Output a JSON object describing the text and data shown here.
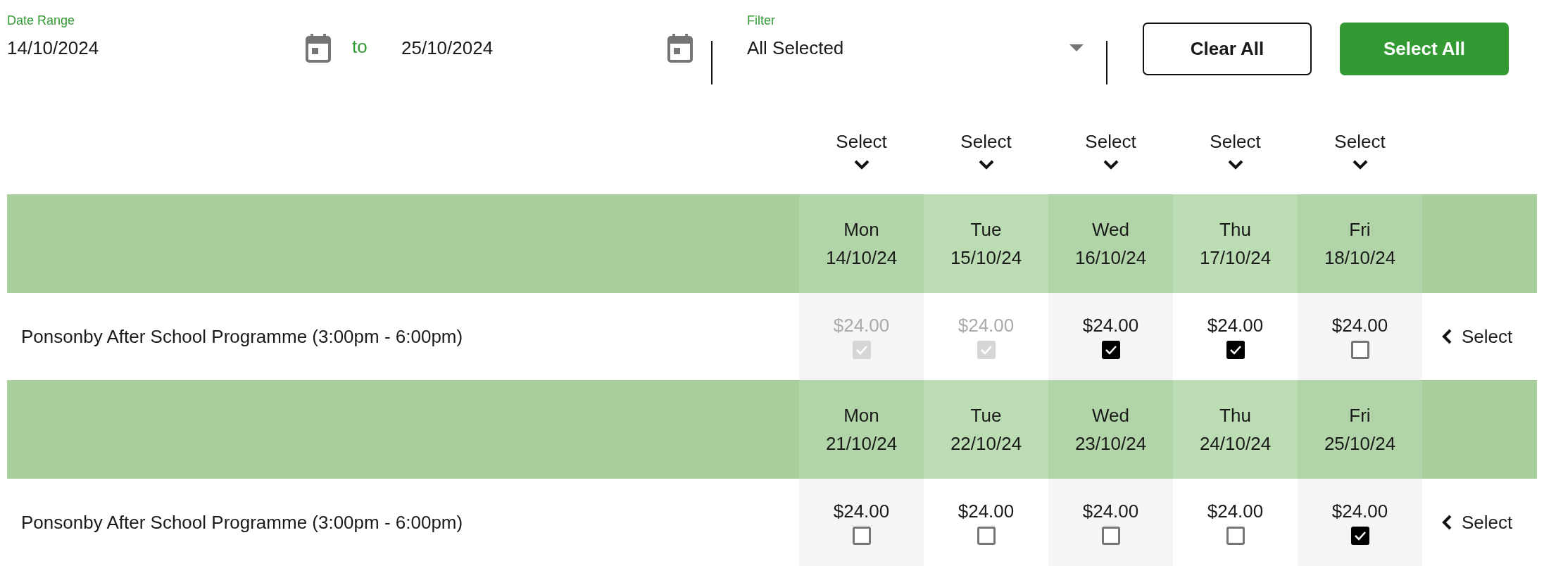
{
  "date_range": {
    "label": "Date Range",
    "start": "14/10/2024",
    "separator": "to",
    "end": "25/10/2024"
  },
  "filter": {
    "label": "Filter",
    "value": "All Selected"
  },
  "buttons": [
    {
      "label": "Clear All",
      "kind": "outline"
    },
    {
      "label": "Select All",
      "kind": "primary"
    }
  ],
  "column_selects": [
    "Select",
    "Select",
    "Select",
    "Select",
    "Select"
  ],
  "weeks": [
    {
      "days": [
        {
          "day": "Mon",
          "date": "14/10/24"
        },
        {
          "day": "Tue",
          "date": "15/10/24"
        },
        {
          "day": "Wed",
          "date": "16/10/24"
        },
        {
          "day": "Thu",
          "date": "17/10/24"
        },
        {
          "day": "Fri",
          "date": "18/10/24"
        }
      ],
      "row": {
        "programme": "Ponsonby After School Programme (3:00pm - 6:00pm)",
        "action": "Select",
        "cells": [
          {
            "price": "$24.00",
            "checked": true,
            "disabled": true
          },
          {
            "price": "$24.00",
            "checked": true,
            "disabled": true
          },
          {
            "price": "$24.00",
            "checked": true,
            "disabled": false
          },
          {
            "price": "$24.00",
            "checked": true,
            "disabled": false
          },
          {
            "price": "$24.00",
            "checked": false,
            "disabled": false
          }
        ]
      }
    },
    {
      "days": [
        {
          "day": "Mon",
          "date": "21/10/24"
        },
        {
          "day": "Tue",
          "date": "22/10/24"
        },
        {
          "day": "Wed",
          "date": "23/10/24"
        },
        {
          "day": "Thu",
          "date": "24/10/24"
        },
        {
          "day": "Fri",
          "date": "25/10/24"
        }
      ],
      "row": {
        "programme": "Ponsonby After School Programme (3:00pm - 6:00pm)",
        "action": "Select",
        "cells": [
          {
            "price": "$24.00",
            "checked": false,
            "disabled": false
          },
          {
            "price": "$24.00",
            "checked": false,
            "disabled": false
          },
          {
            "price": "$24.00",
            "checked": false,
            "disabled": false
          },
          {
            "price": "$24.00",
            "checked": false,
            "disabled": false
          },
          {
            "price": "$24.00",
            "checked": true,
            "disabled": false
          }
        ]
      }
    }
  ]
}
